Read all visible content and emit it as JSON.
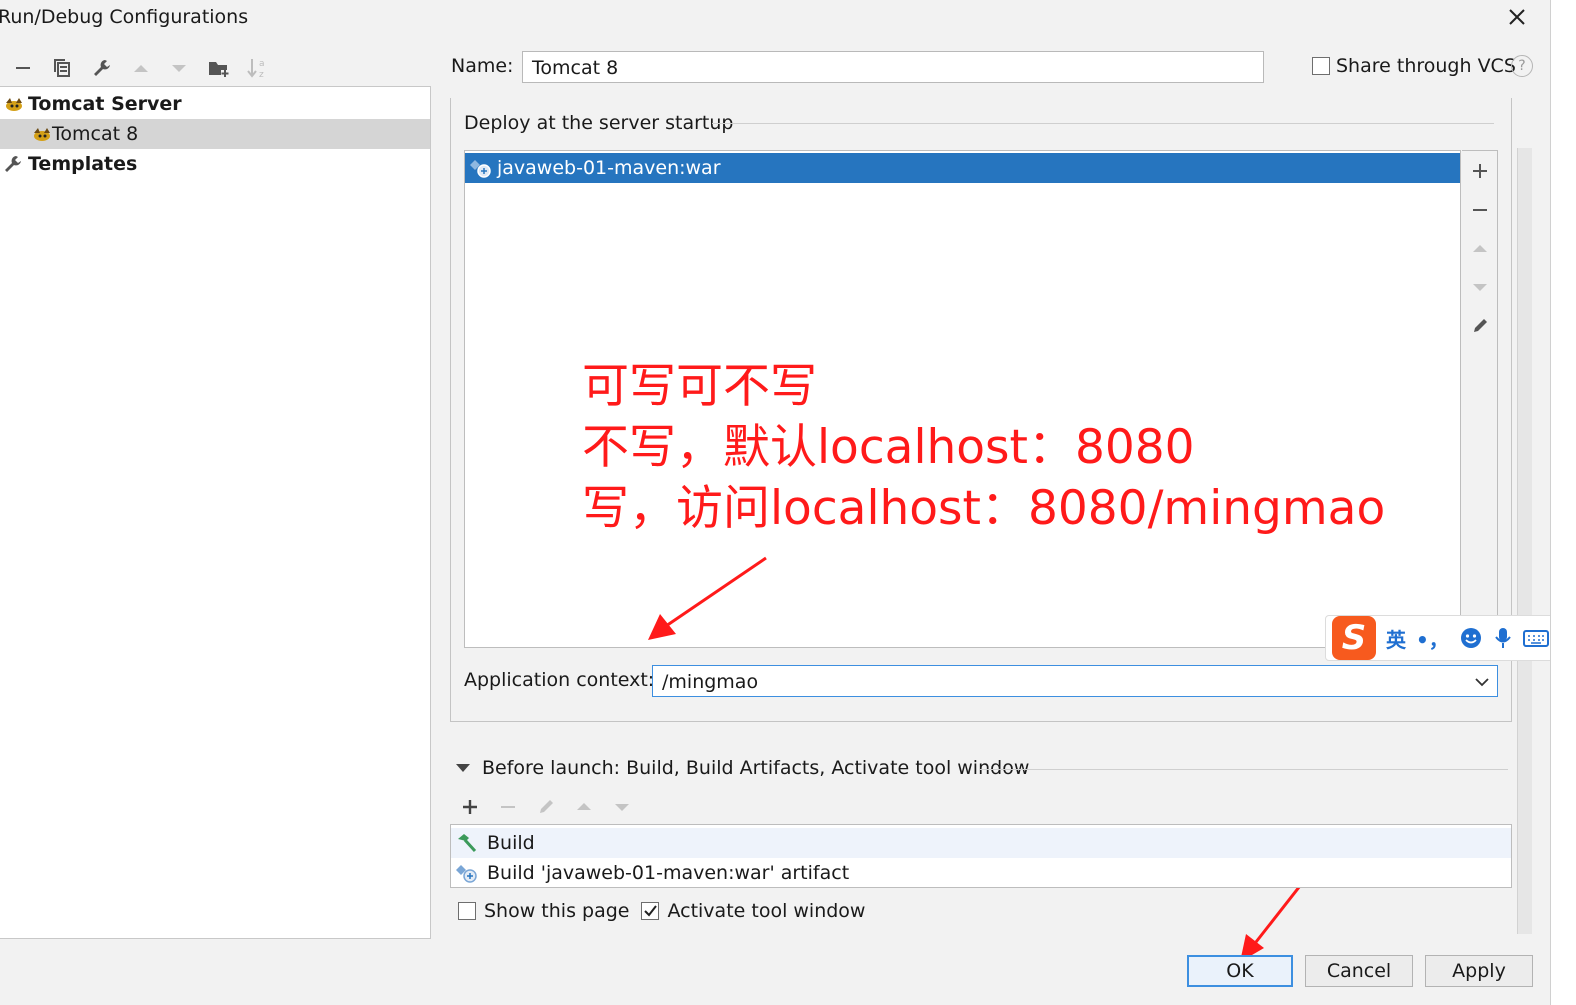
{
  "window": {
    "title": "Run/Debug Configurations"
  },
  "tree": {
    "items": [
      {
        "label": "Tomcat Server"
      },
      {
        "label": "Tomcat 8"
      },
      {
        "label": "Templates"
      }
    ]
  },
  "name_field": {
    "label": "Name:",
    "value": "Tomcat 8"
  },
  "share": {
    "label": "Share through VCS",
    "checked": false
  },
  "deploy": {
    "section_label": "Deploy at the server startup",
    "items": [
      {
        "label": "javaweb-01-maven:war"
      }
    ]
  },
  "annotation": {
    "lines": [
      "可写可不写",
      "不写，默认localhost：8080",
      "写，访问localhost：8080/mingmao"
    ],
    "color": "#ff1a1a"
  },
  "app_context": {
    "label": "Application context:",
    "value": "/mingmao"
  },
  "ime": {
    "mode": "英",
    "punct": "•，"
  },
  "before_launch": {
    "label": "Before launch: Build, Build Artifacts, Activate tool window",
    "items": [
      {
        "label": "Build"
      },
      {
        "label": "Build 'javaweb-01-maven:war' artifact"
      }
    ]
  },
  "options": {
    "show_page": {
      "label": "Show this page",
      "checked": false
    },
    "activate": {
      "label": "Activate tool window",
      "checked": true
    }
  },
  "buttons": {
    "ok": "OK",
    "cancel": "Cancel",
    "apply": "Apply"
  },
  "colors": {
    "selection": "#2675bf",
    "accent": "#3d8fe0"
  }
}
